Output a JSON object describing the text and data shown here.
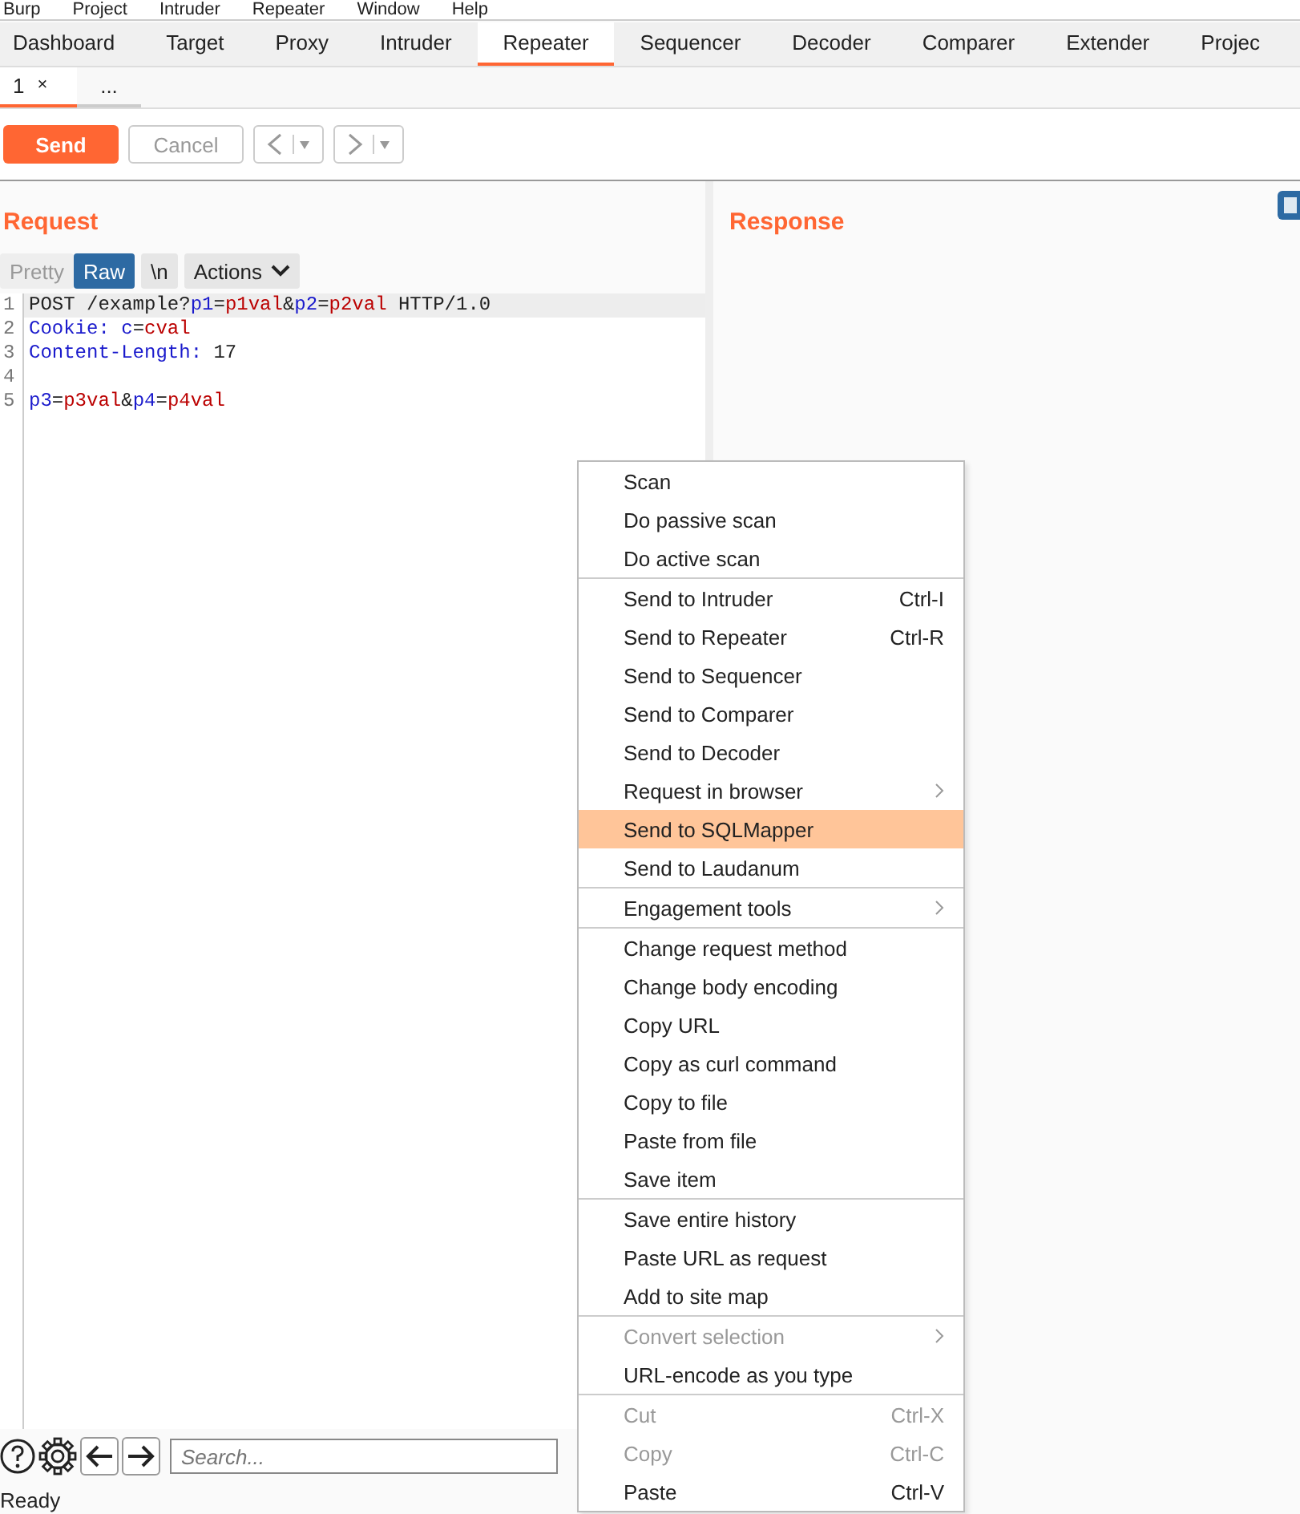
{
  "menu_bar": [
    "Burp",
    "Project",
    "Intruder",
    "Repeater",
    "Window",
    "Help"
  ],
  "tabs": [
    {
      "label": "Dashboard",
      "selected": false
    },
    {
      "label": "Target",
      "selected": false
    },
    {
      "label": "Proxy",
      "selected": false
    },
    {
      "label": "Intruder",
      "selected": false
    },
    {
      "label": "Repeater",
      "selected": true
    },
    {
      "label": "Sequencer",
      "selected": false
    },
    {
      "label": "Decoder",
      "selected": false
    },
    {
      "label": "Comparer",
      "selected": false
    },
    {
      "label": "Extender",
      "selected": false
    },
    {
      "label": "Projec",
      "selected": false
    }
  ],
  "sub_tabs": [
    {
      "label": "1",
      "close": "×",
      "selected": true
    },
    {
      "label": "...",
      "selected": false
    }
  ],
  "toolbar": {
    "send": "Send",
    "cancel": "Cancel"
  },
  "request": {
    "title": "Request",
    "view_buttons": [
      {
        "label": "Pretty",
        "selected": false
      },
      {
        "label": "Raw",
        "selected": true
      },
      {
        "label": "\\n",
        "selected": false
      }
    ],
    "actions": "Actions",
    "lines": [
      {
        "number": "1",
        "current": true,
        "tokens": [
          {
            "kind": "plain",
            "text": "POST /example?"
          },
          {
            "kind": "name",
            "text": "p1"
          },
          {
            "kind": "plain",
            "text": "="
          },
          {
            "kind": "value",
            "text": "p1val"
          },
          {
            "kind": "plain",
            "text": "&"
          },
          {
            "kind": "name",
            "text": "p2"
          },
          {
            "kind": "plain",
            "text": "="
          },
          {
            "kind": "value",
            "text": "p2val"
          },
          {
            "kind": "plain",
            "text": " HTTP/1.0"
          }
        ]
      },
      {
        "number": "2",
        "current": false,
        "tokens": [
          {
            "kind": "name",
            "text": "Cookie: c"
          },
          {
            "kind": "plain",
            "text": "="
          },
          {
            "kind": "value",
            "text": "cval"
          }
        ]
      },
      {
        "number": "3",
        "current": false,
        "tokens": [
          {
            "kind": "name",
            "text": "Content-Length:"
          },
          {
            "kind": "plain",
            "text": " 17"
          }
        ]
      },
      {
        "number": "4",
        "current": false
      },
      {
        "number": "5",
        "current": false,
        "tokens": [
          {
            "kind": "name",
            "text": "p3"
          },
          {
            "kind": "plain",
            "text": "="
          },
          {
            "kind": "value",
            "text": "p3val"
          },
          {
            "kind": "plain",
            "text": "&"
          },
          {
            "kind": "name",
            "text": "p4"
          },
          {
            "kind": "plain",
            "text": "="
          },
          {
            "kind": "value",
            "text": "p4val"
          }
        ]
      }
    ],
    "search": {
      "placeholder": "Search..."
    }
  },
  "response": {
    "title": "Response"
  },
  "status_bar": "Ready",
  "context_menu": [
    [
      {
        "label": "Scan",
        "disabled": false,
        "selected": false,
        "submenu": false
      },
      {
        "label": "Do passive scan",
        "disabled": false,
        "selected": false,
        "submenu": false
      },
      {
        "label": "Do active scan",
        "disabled": false,
        "selected": false,
        "submenu": false
      }
    ],
    [
      {
        "label": "Send to Intruder",
        "shortcut": "Ctrl-I",
        "disabled": false,
        "selected": false,
        "submenu": false
      },
      {
        "label": "Send to Repeater",
        "shortcut": "Ctrl-R",
        "disabled": false,
        "selected": false,
        "submenu": false
      },
      {
        "label": "Send to Sequencer",
        "disabled": false,
        "selected": false,
        "submenu": false
      },
      {
        "label": "Send to Comparer",
        "disabled": false,
        "selected": false,
        "submenu": false
      },
      {
        "label": "Send to Decoder",
        "disabled": false,
        "selected": false,
        "submenu": false
      },
      {
        "label": "Request in browser",
        "disabled": false,
        "selected": false,
        "submenu": true
      },
      {
        "label": "Send to SQLMapper",
        "disabled": false,
        "selected": true,
        "submenu": false
      },
      {
        "label": "Send to Laudanum",
        "disabled": false,
        "selected": false,
        "submenu": false
      }
    ],
    [
      {
        "label": "Engagement tools",
        "disabled": false,
        "selected": false,
        "submenu": true
      }
    ],
    [
      {
        "label": "Change request method",
        "disabled": false,
        "selected": false,
        "submenu": false
      },
      {
        "label": "Change body encoding",
        "disabled": false,
        "selected": false,
        "submenu": false
      },
      {
        "label": "Copy URL",
        "disabled": false,
        "selected": false,
        "submenu": false
      },
      {
        "label": "Copy as curl command",
        "disabled": false,
        "selected": false,
        "submenu": false
      },
      {
        "label": "Copy to file",
        "disabled": false,
        "selected": false,
        "submenu": false
      },
      {
        "label": "Paste from file",
        "disabled": false,
        "selected": false,
        "submenu": false
      },
      {
        "label": "Save item",
        "disabled": false,
        "selected": false,
        "submenu": false
      }
    ],
    [
      {
        "label": "Save entire history",
        "disabled": false,
        "selected": false,
        "submenu": false
      },
      {
        "label": "Paste URL as request",
        "disabled": false,
        "selected": false,
        "submenu": false
      },
      {
        "label": "Add to site map",
        "disabled": false,
        "selected": false,
        "submenu": false
      }
    ],
    [
      {
        "label": "Convert selection",
        "disabled": true,
        "selected": false,
        "submenu": true
      },
      {
        "label": "URL-encode as you type",
        "disabled": false,
        "selected": false,
        "submenu": false
      }
    ],
    [
      {
        "label": "Cut",
        "shortcut": "Ctrl-X",
        "disabled": true,
        "selected": false,
        "submenu": false
      },
      {
        "label": "Copy",
        "shortcut": "Ctrl-C",
        "disabled": true,
        "selected": false,
        "submenu": false
      },
      {
        "label": "Paste",
        "shortcut": "Ctrl-V",
        "disabled": false,
        "selected": false,
        "submenu": false
      }
    ]
  ]
}
